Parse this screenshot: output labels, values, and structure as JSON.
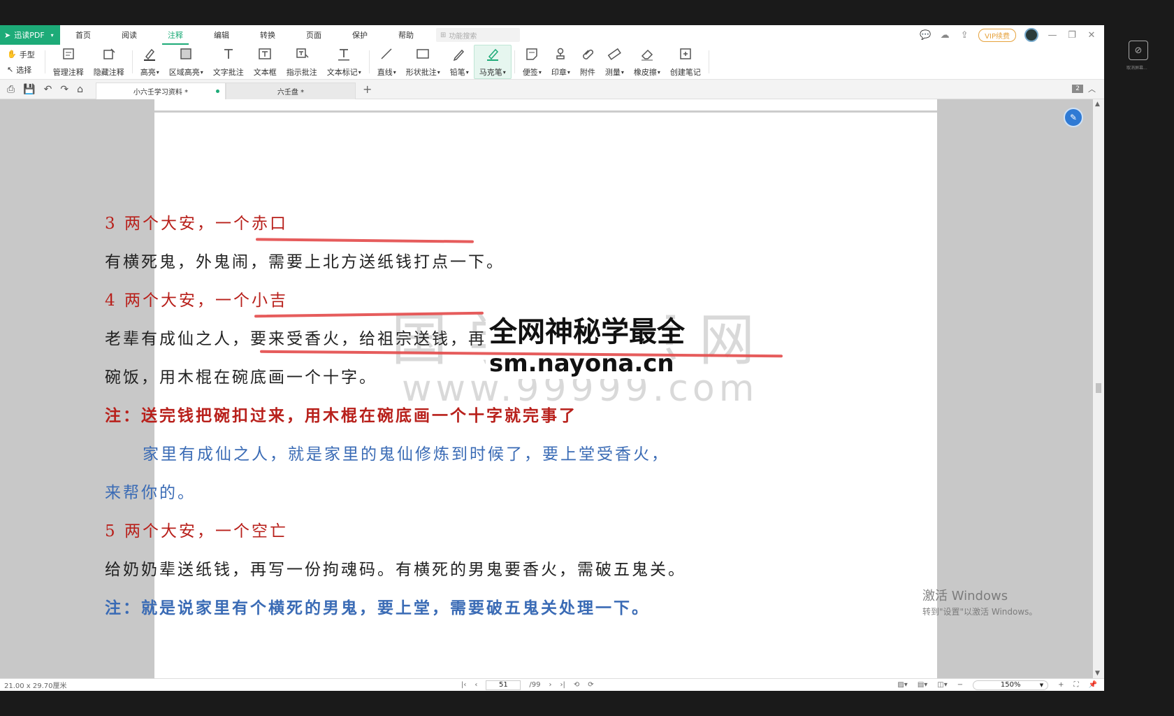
{
  "titlebar": {
    "app_name": "迅读PDF",
    "menus": [
      "首页",
      "阅读",
      "注释",
      "编辑",
      "转换",
      "页面",
      "保护",
      "帮助"
    ],
    "active_menu": "注释",
    "search_placeholder": "功能搜索",
    "vip_label": "VIP续费"
  },
  "ribbon": {
    "hand_tool": "手型",
    "select_tool": "选择",
    "tools": [
      {
        "label": "管理注释",
        "icon": "manage-annotations-icon"
      },
      {
        "label": "隐藏注释",
        "icon": "hide-annotations-icon"
      },
      {
        "label": "高亮",
        "icon": "highlight-icon",
        "dropdown": true
      },
      {
        "label": "区域高亮",
        "icon": "area-highlight-icon",
        "dropdown": true
      },
      {
        "label": "文字批注",
        "icon": "text-comment-icon"
      },
      {
        "label": "文本框",
        "icon": "textbox-icon"
      },
      {
        "label": "指示批注",
        "icon": "callout-icon"
      },
      {
        "label": "文本标记",
        "icon": "text-markup-icon",
        "dropdown": true
      },
      {
        "label": "直线",
        "icon": "line-icon",
        "dropdown": true
      },
      {
        "label": "形状批注",
        "icon": "shape-icon",
        "dropdown": true
      },
      {
        "label": "铅笔",
        "icon": "pencil-icon",
        "dropdown": true
      },
      {
        "label": "马克笔",
        "icon": "marker-icon",
        "dropdown": true,
        "active": true
      },
      {
        "label": "便签",
        "icon": "sticky-note-icon",
        "dropdown": true
      },
      {
        "label": "印章",
        "icon": "stamp-icon",
        "dropdown": true
      },
      {
        "label": "附件",
        "icon": "attachment-icon"
      },
      {
        "label": "测量",
        "icon": "measure-icon",
        "dropdown": true
      },
      {
        "label": "橡皮擦",
        "icon": "eraser-icon",
        "dropdown": true
      },
      {
        "label": "创建笔记",
        "icon": "create-note-icon"
      }
    ]
  },
  "tabs": {
    "items": [
      {
        "label": "小六壬学习资料 *",
        "active": true
      },
      {
        "label": "六壬盘 *",
        "active": false
      }
    ],
    "page_badge": "2"
  },
  "document": {
    "lines": [
      {
        "text": "3 两个大安，一个赤口",
        "style": "red"
      },
      {
        "text": "有横死鬼，外鬼闹，需要上北方送纸钱打点一下。",
        "style": "dark"
      },
      {
        "text": "4 两个大安，一个小吉",
        "style": "red"
      },
      {
        "text": "老辈有成仙之人，要来受香火，给祖宗送钱，再送一",
        "style": "dark"
      },
      {
        "text": "碗饭，用木棍在碗底画一个十字。",
        "style": "dark"
      },
      {
        "text": "注：送完钱把碗扣过来，用木棍在碗底画一个十字就完事了",
        "style": "red-bold"
      },
      {
        "text": "家里有成仙之人，就是家里的鬼仙修炼到时候了，要上堂受香火，",
        "style": "blue"
      },
      {
        "text": "来帮你的。",
        "style": "blue"
      },
      {
        "text": "5 两个大安，一个空亡",
        "style": "red"
      },
      {
        "text": "给奶奶辈送纸钱，再写一份拘魂码。有横死的男鬼要香火，需破五鬼关。",
        "style": "dark"
      },
      {
        "text": "注：就是说家里有个横死的男鬼，要上堂，需要破五鬼关处理一下。",
        "style": "blue-bold"
      }
    ],
    "watermark_back": "国学资源网",
    "watermark_back_url": "www.99999.com",
    "watermark_title": "全网神秘学最全",
    "watermark_url": "sm.nayona.cn"
  },
  "windows_activation": {
    "line1": "激活 Windows",
    "line2": "转到\"设置\"以激活 Windows。"
  },
  "statusbar": {
    "page_size": "21.00 x 29.70厘米",
    "current_page": "51",
    "total_pages": "/99",
    "zoom": "150%"
  },
  "side_panel": {
    "label": "取消屏幕..."
  }
}
